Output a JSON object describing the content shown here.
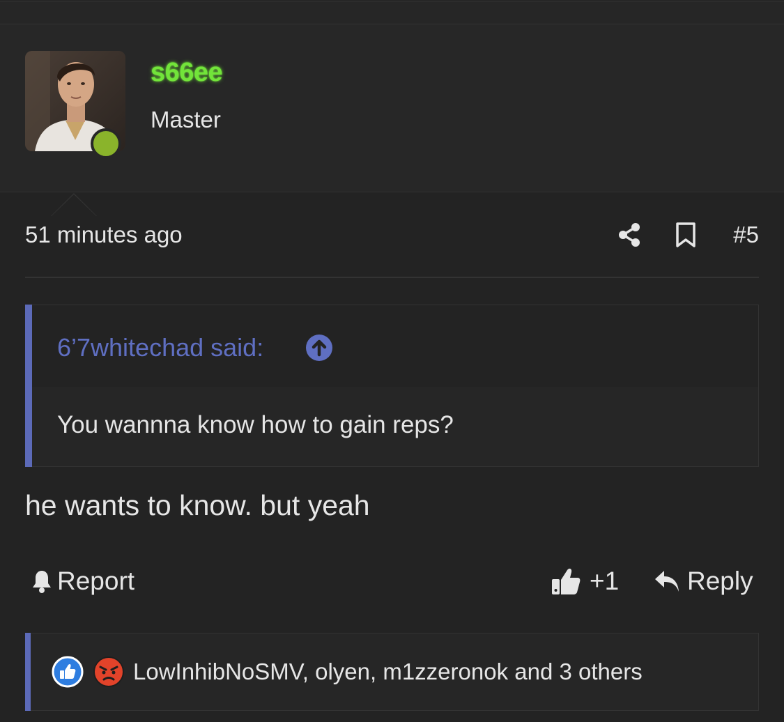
{
  "user": {
    "username": "s66ee",
    "title": "Master"
  },
  "post": {
    "timestamp": "51 minutes ago",
    "number": "#5",
    "quote_author": "6’7whitechad said:",
    "quote_text": "You wannna know how to gain reps?",
    "message": "he wants to know. but yeah"
  },
  "actions": {
    "report_label": "Report",
    "like_count": "+1",
    "reply_label": "Reply"
  },
  "reactions": {
    "users_text": "LowInhibNoSMV, olyen, m1zzeronok and 3 others",
    "types": [
      "like-icon",
      "angry-icon"
    ]
  },
  "colors": {
    "username": "#72e43a",
    "online": "#8ab42b",
    "accent": "#5c6ab8",
    "background": "#232323"
  }
}
